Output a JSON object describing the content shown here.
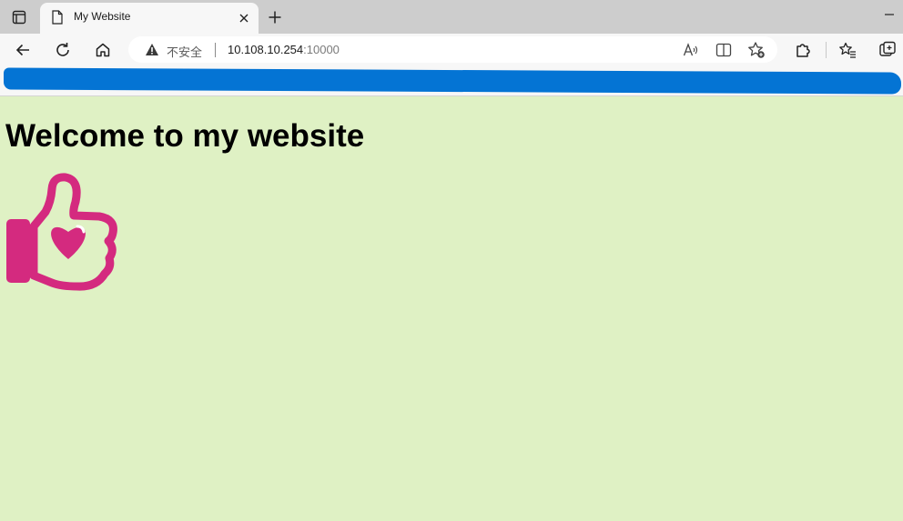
{
  "browser": {
    "tab": {
      "title": "My Website"
    },
    "address_bar": {
      "security_label": "不安全",
      "url_host": "10.108.10.254",
      "url_port": ":10000"
    },
    "icons": [
      "tab-actions-icon",
      "page-icon",
      "close-icon",
      "plus-icon",
      "minimize-icon",
      "back-arrow-icon",
      "refresh-icon",
      "home-icon",
      "warning-icon",
      "read-aloud-icon",
      "split-screen-icon",
      "add-favorite-icon",
      "extensions-icon",
      "favorites-icon",
      "collections-icon"
    ]
  },
  "page": {
    "heading": "Welcome to my website",
    "background_color": "#dff1c4",
    "icon_color": "#d42a7f",
    "image": "thumbs-up-heart-icon"
  }
}
